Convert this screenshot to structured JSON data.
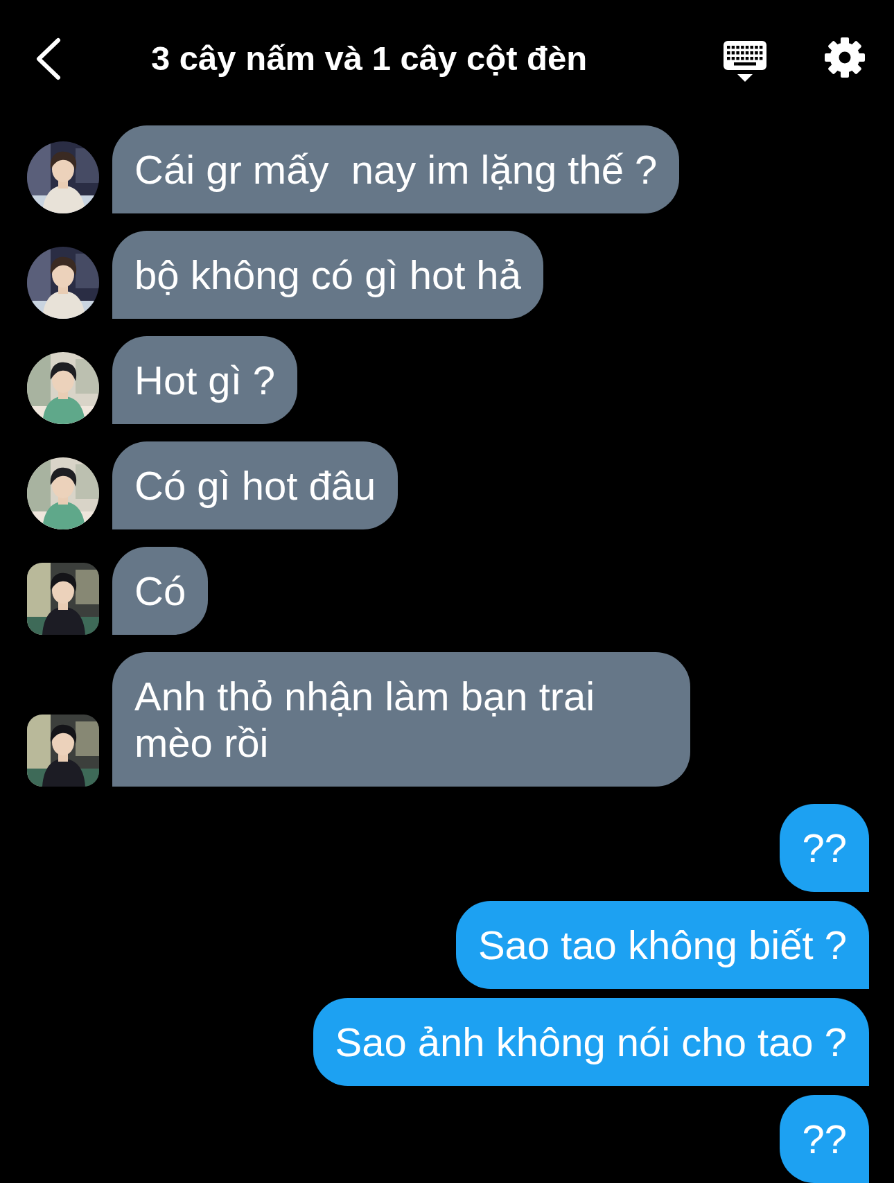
{
  "header": {
    "title": "3 cây nấm và 1 cây cột đèn"
  },
  "messages": [
    {
      "kind": "received",
      "text": "Cái gr mấy  nay im lặng thế ?",
      "avatar_square": false
    },
    {
      "kind": "received",
      "text": "bộ không có gì hot hả",
      "avatar_square": false
    },
    {
      "kind": "received",
      "text": "Hot gì ?",
      "avatar_square": false
    },
    {
      "kind": "received",
      "text": "Có gì hot đâu",
      "avatar_square": false
    },
    {
      "kind": "received",
      "text": "Có",
      "avatar_square": true
    },
    {
      "kind": "received",
      "text": "Anh thỏ nhận làm bạn trai mèo rồi",
      "avatar_square": true
    },
    {
      "kind": "sent",
      "text": "??"
    },
    {
      "kind": "sent",
      "text": "Sao tao không biết ?"
    },
    {
      "kind": "sent",
      "text": "Sao ảnh không nói cho tao ?"
    },
    {
      "kind": "sent",
      "text": "??"
    }
  ]
}
